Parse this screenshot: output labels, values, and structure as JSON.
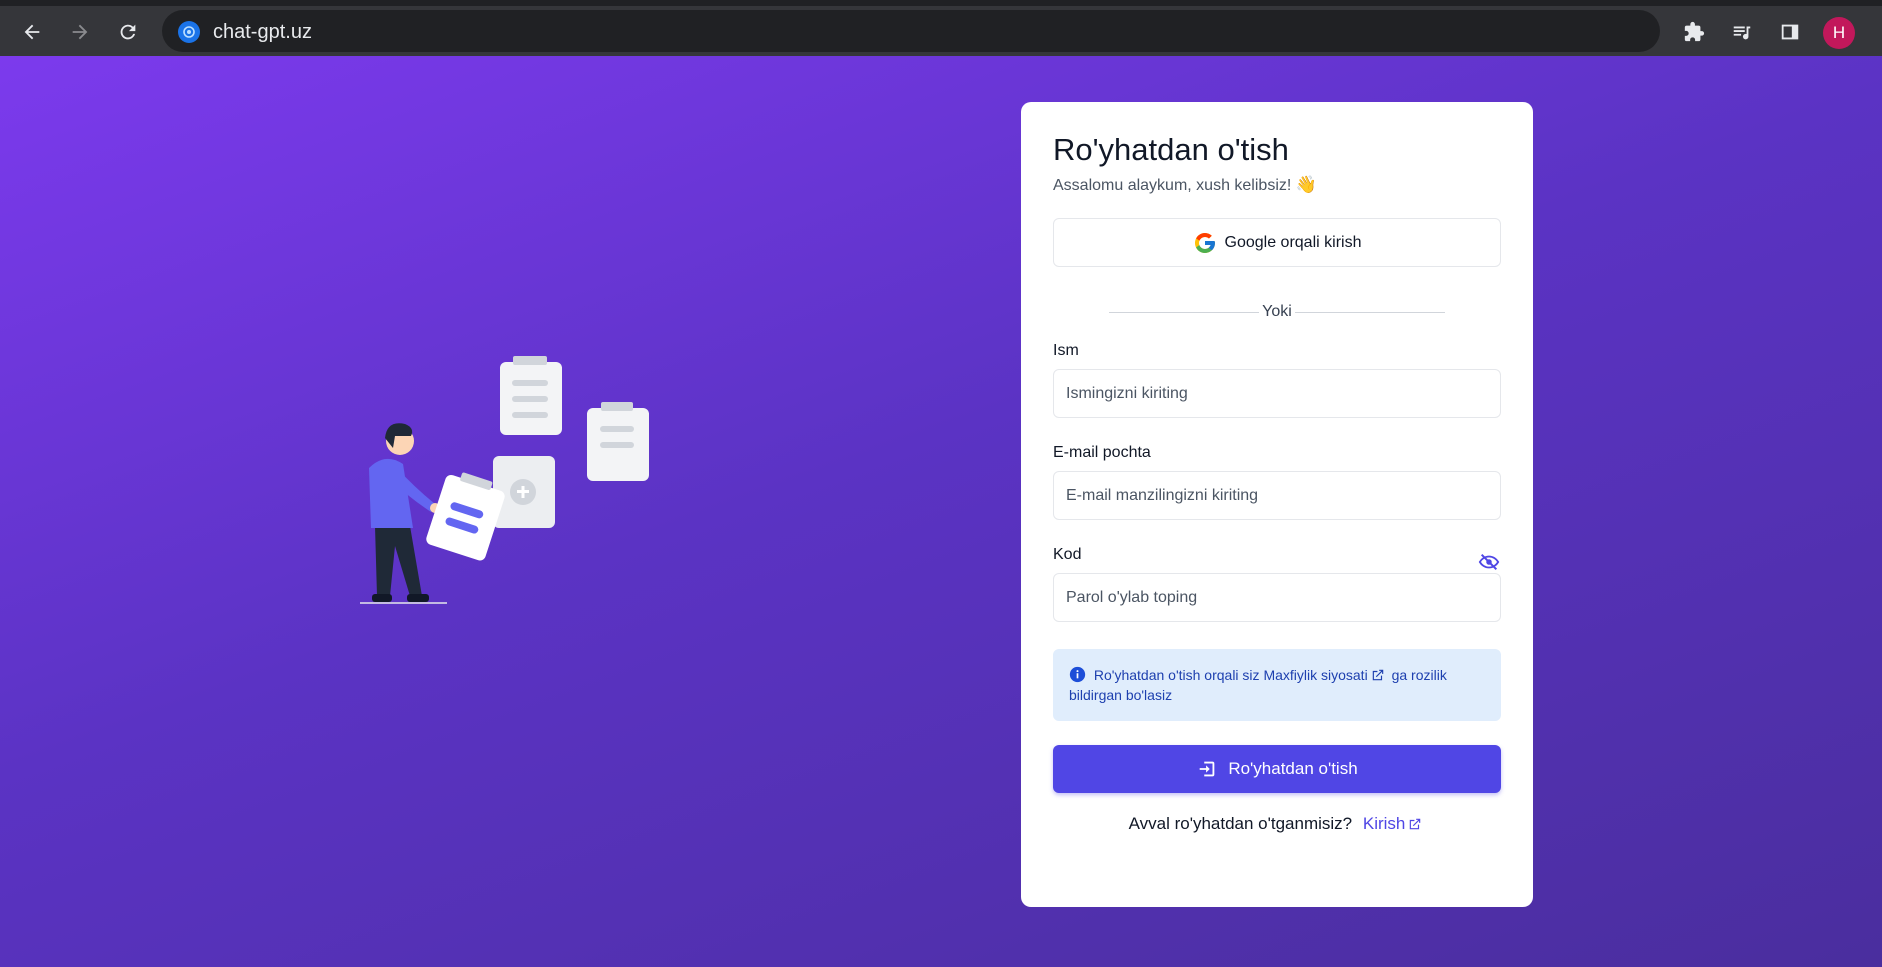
{
  "browser": {
    "url": "chat-gpt.uz",
    "profile_initial": "H"
  },
  "card": {
    "title": "Ro'yhatdan o'tish",
    "subtitle": "Assalomu alaykum, xush kelibsiz!",
    "subtitle_emoji": "👋",
    "google_button": "Google orqali kirish",
    "divider_text": "Yoki",
    "fields": {
      "name": {
        "label": "Ism",
        "placeholder": "Ismingizni kiriting"
      },
      "email": {
        "label": "E-mail pochta",
        "placeholder": "E-mail manzilingizni kiriting"
      },
      "password": {
        "label": "Kod",
        "placeholder": "Parol o'ylab toping"
      }
    },
    "notice": {
      "prefix": "Ro'yhatdan o'tish orqali siz",
      "link": "Maxfiylik siyosati",
      "suffix": "ga rozilik bildirgan bo'lasiz"
    },
    "submit_button": "Ro'yhatdan o'tish",
    "footer": {
      "question": "Avval ro'yhatdan o'tganmisiz?",
      "login_link": "Kirish"
    }
  },
  "colors": {
    "accent": "#5046e5",
    "gradient_start": "#7c3aed",
    "gradient_end": "#4a2e9e",
    "notice_bg": "#e0edfc"
  }
}
